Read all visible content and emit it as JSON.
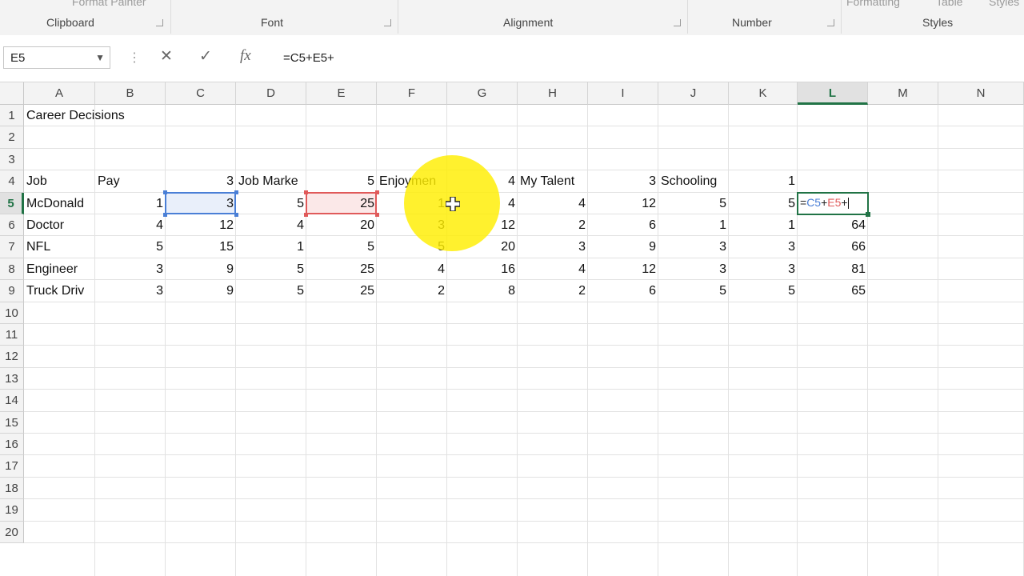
{
  "ribbon": {
    "top_clip_left": "Format Painter",
    "top_clip_right_1": "Formatting",
    "top_clip_right_2": "Table",
    "top_clip_right_3": "Styles",
    "groups": [
      "Clipboard",
      "Font",
      "Alignment",
      "Number",
      "Styles"
    ]
  },
  "formula_bar": {
    "name_box": "E5",
    "cancel_glyph": "✕",
    "enter_glyph": "✓",
    "fx_glyph": "fx",
    "formula": "=C5+E5+"
  },
  "columns": [
    "A",
    "B",
    "C",
    "D",
    "E",
    "F",
    "G",
    "H",
    "I",
    "J",
    "K",
    "L",
    "M",
    "N"
  ],
  "active_column": "L",
  "rows": [
    "1",
    "2",
    "3",
    "4",
    "5",
    "6",
    "7",
    "8",
    "9",
    "10",
    "11",
    "12",
    "13",
    "14",
    "15",
    "16",
    "17",
    "18",
    "19",
    "20"
  ],
  "active_row": "5",
  "cells": {
    "A1": "Career Decisions",
    "A4": "Job",
    "B4": "Pay",
    "C4": "3",
    "D4": "Job Marke",
    "E4": "5",
    "F4": "Enjoymen",
    "G4": "4",
    "H4": "My Talent",
    "I4": "3",
    "J4": "Schooling",
    "K4": "1",
    "A5": "McDonald",
    "B5": "1",
    "C5": "3",
    "D5": "5",
    "E5": "25",
    "F5": "1",
    "G5": "4",
    "H5": "4",
    "I5": "12",
    "J5": "5",
    "K5": "5",
    "A6": "Doctor",
    "B6": "4",
    "C6": "12",
    "D6": "4",
    "E6": "20",
    "F6": "3",
    "G6": "12",
    "H6": "2",
    "I6": "6",
    "J6": "1",
    "K6": "1",
    "L6": "64",
    "A7": "NFL",
    "B7": "5",
    "C7": "15",
    "D7": "1",
    "E7": "5",
    "F7": "5",
    "G7": "20",
    "H7": "3",
    "I7": "9",
    "J7": "3",
    "K7": "3",
    "L7": "66",
    "A8": "Engineer",
    "B8": "3",
    "C8": "9",
    "D8": "5",
    "E8": "25",
    "F8": "4",
    "G8": "16",
    "H8": "4",
    "I8": "12",
    "J8": "3",
    "K8": "3",
    "L8": "81",
    "A9": "Truck Driv",
    "B9": "3",
    "C9": "9",
    "D9": "5",
    "E9": "25",
    "F9": "2",
    "G9": "8",
    "H9": "2",
    "I9": "6",
    "J9": "5",
    "K9": "5",
    "L9": "65"
  },
  "editing_cell": {
    "address": "L5",
    "parts": [
      {
        "text": "=",
        "cls": "op"
      },
      {
        "text": "C5",
        "cls": "r1"
      },
      {
        "text": "+",
        "cls": "op"
      },
      {
        "text": "E5",
        "cls": "r2"
      },
      {
        "text": "+",
        "cls": "op"
      }
    ]
  },
  "referenced_ranges": [
    {
      "address": "C5",
      "color": "#4a7fd6"
    },
    {
      "address": "E5",
      "color": "#e05a5a"
    }
  ],
  "highlight_color": "#ffee00",
  "accent_color": "#217346"
}
